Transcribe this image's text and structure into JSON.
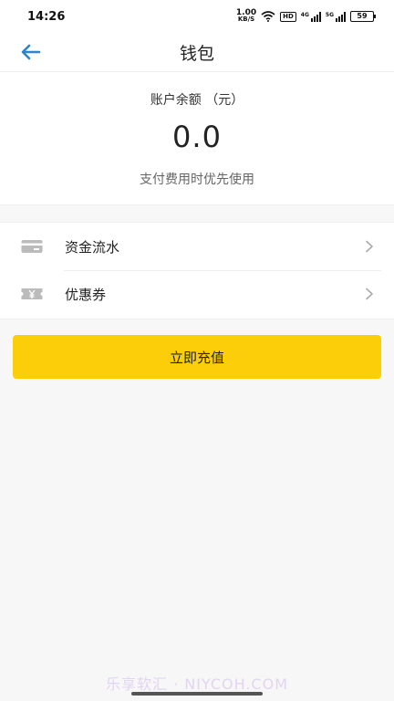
{
  "status_bar": {
    "time": "14:26",
    "net_speed_value": "1.00",
    "net_speed_unit": "KB/S",
    "hd_label": "HD",
    "signal1_label": "4G",
    "signal2_label": "5G",
    "battery": "59"
  },
  "nav": {
    "title": "钱包",
    "back_icon": "arrow-left-icon"
  },
  "balance": {
    "label": "账户余额 （元）",
    "value": "0.0",
    "note": "支付费用时优先使用"
  },
  "menu": {
    "items": [
      {
        "label": "资金流水",
        "icon": "card-icon"
      },
      {
        "label": "优惠券",
        "icon": "coupon-icon"
      }
    ]
  },
  "recharge": {
    "label": "立即充值"
  },
  "watermark": "乐享软汇 · NIYCOH.COM",
  "colors": {
    "accent": "#fcce0a",
    "back_arrow": "#2a86c8",
    "icon_gray": "#bbbbbb"
  }
}
